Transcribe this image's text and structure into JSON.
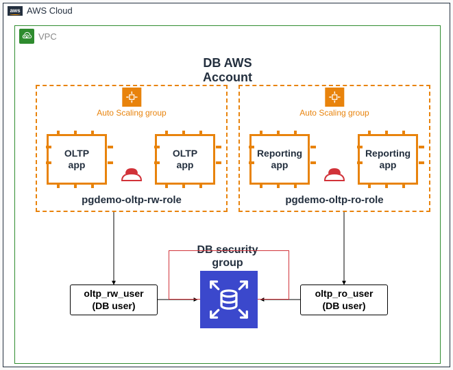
{
  "cloud": {
    "label": "AWS Cloud"
  },
  "vpc": {
    "label": "VPC"
  },
  "account_title": "DB AWS\nAccount",
  "asg": {
    "label": "Auto Scaling group",
    "left": {
      "ec2_a": "OLTP\napp",
      "ec2_b": "OLTP\napp",
      "role": "pgdemo-oltp-rw-role"
    },
    "right": {
      "ec2_a": "Reporting\napp",
      "ec2_b": "Reporting\napp",
      "role": "pgdemo-oltp-ro-role"
    }
  },
  "sg": {
    "label": "DB security\ngroup"
  },
  "users": {
    "rw": "oltp_rw_user\n(DB user)",
    "ro": "oltp_ro_user\n(DB user)"
  }
}
